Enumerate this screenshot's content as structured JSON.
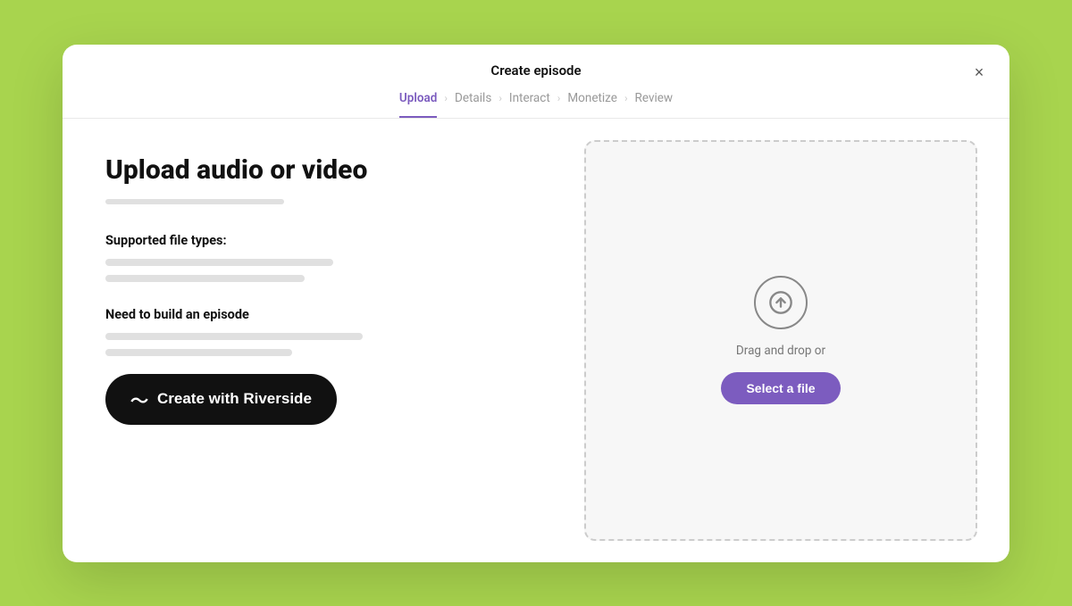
{
  "modal": {
    "title": "Create episode",
    "close_label": "×"
  },
  "stepper": {
    "steps": [
      {
        "id": "upload",
        "label": "Upload",
        "active": true
      },
      {
        "id": "details",
        "label": "Details",
        "active": false
      },
      {
        "id": "interact",
        "label": "Interact",
        "active": false
      },
      {
        "id": "monetize",
        "label": "Monetize",
        "active": false
      },
      {
        "id": "review",
        "label": "Review",
        "active": false
      }
    ]
  },
  "left": {
    "page_title": "Upload audio or video",
    "supported_label": "Supported file types:",
    "placeholder_line1_width": "55%",
    "placeholder_line2_width": "48%",
    "need_label": "Need to build an episode",
    "placeholder_line3_width": "62%",
    "placeholder_line4_width": "45%",
    "create_btn_label": "Create with Riverside"
  },
  "right": {
    "drag_text": "Drag and drop or",
    "select_btn_label": "Select a file"
  },
  "icons": {
    "waveform": "〜",
    "upload_arrow": "↑"
  }
}
